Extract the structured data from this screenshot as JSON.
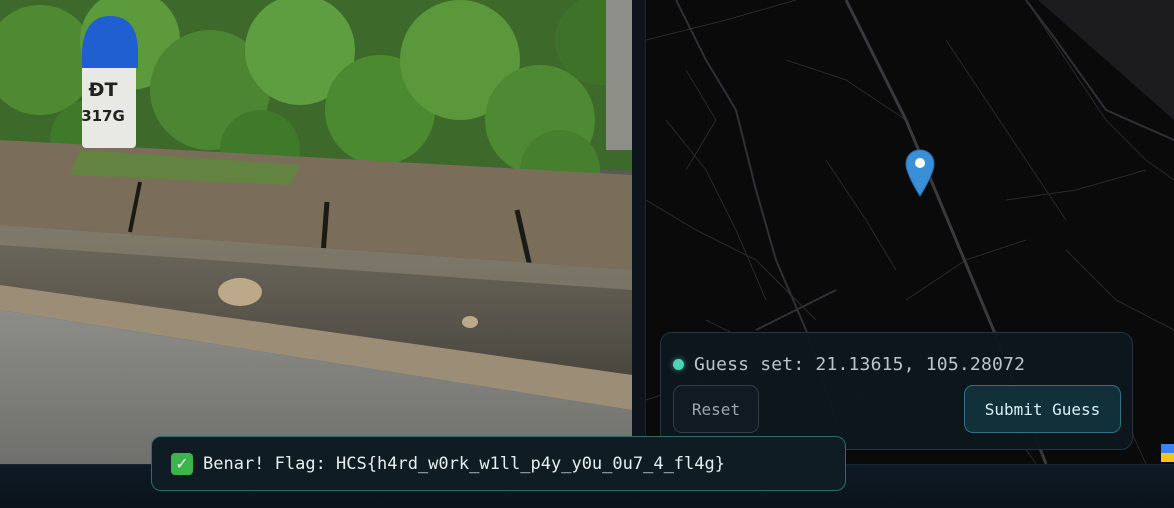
{
  "photo": {
    "milestone_line1": "ĐT",
    "milestone_line2": "317G"
  },
  "map": {
    "pin_color": "#3a8fd9"
  },
  "guess_panel": {
    "status_text": "Guess set: 21.13615, 105.28072",
    "status_color": "#4fd1b5",
    "reset_label": "Reset",
    "submit_label": "Submit Guess"
  },
  "toast": {
    "icon": "check-icon",
    "message": "Benar! Flag: HCS{h4rd_w0rk_w1ll_p4y_y0u_0u7_4_fl4g}"
  }
}
